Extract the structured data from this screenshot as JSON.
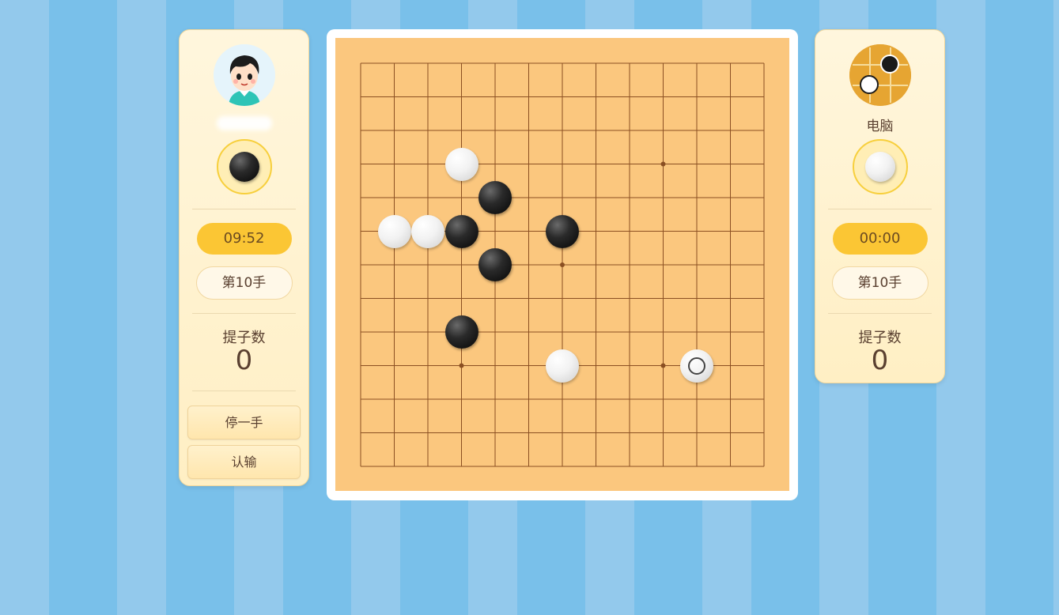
{
  "left_player": {
    "name": "",
    "stone_color": "black",
    "timer": "09:52",
    "move_label": "第10手",
    "captures_label": "提子数",
    "captures": "0",
    "buttons": {
      "pass": "停一手",
      "resign": "认输"
    }
  },
  "right_player": {
    "name": "电脑",
    "stone_color": "white",
    "timer": "00:00",
    "move_label": "第10手",
    "captures_label": "提子数",
    "captures": "0"
  },
  "board": {
    "size": 13,
    "star_points": [
      [
        3,
        3
      ],
      [
        9,
        3
      ],
      [
        6,
        6
      ],
      [
        3,
        9
      ],
      [
        9,
        9
      ]
    ],
    "stones": [
      {
        "color": "white",
        "col": 3,
        "row": 3
      },
      {
        "color": "black",
        "col": 4,
        "row": 4
      },
      {
        "color": "white",
        "col": 1,
        "row": 5
      },
      {
        "color": "white",
        "col": 2,
        "row": 5
      },
      {
        "color": "black",
        "col": 3,
        "row": 5
      },
      {
        "color": "black",
        "col": 6,
        "row": 5
      },
      {
        "color": "black",
        "col": 4,
        "row": 6
      },
      {
        "color": "black",
        "col": 3,
        "row": 8
      },
      {
        "color": "white",
        "col": 6,
        "row": 9
      },
      {
        "color": "white",
        "col": 10,
        "row": 9,
        "last": true
      }
    ]
  },
  "colors": {
    "board": "#fbc77e",
    "grid": "#8b4f22",
    "timer": "#fbc634"
  }
}
